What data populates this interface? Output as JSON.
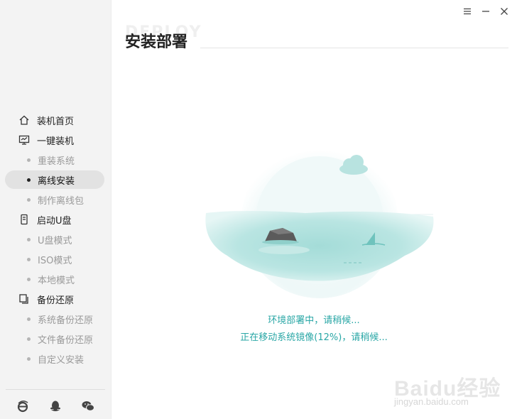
{
  "sidebar": {
    "items": [
      {
        "label": "装机首页",
        "icon": "home-icon",
        "type": "group"
      },
      {
        "label": "一键装机",
        "icon": "monitor-icon",
        "type": "group"
      },
      {
        "label": "重装系统",
        "type": "sub"
      },
      {
        "label": "离线安装",
        "type": "sub",
        "active": true
      },
      {
        "label": "制作离线包",
        "type": "sub"
      },
      {
        "label": "启动U盘",
        "icon": "usb-icon",
        "type": "group"
      },
      {
        "label": "U盘模式",
        "type": "sub"
      },
      {
        "label": "ISO模式",
        "type": "sub"
      },
      {
        "label": "本地模式",
        "type": "sub"
      },
      {
        "label": "备份还原",
        "icon": "backup-icon",
        "type": "group"
      },
      {
        "label": "系统备份还原",
        "type": "sub"
      },
      {
        "label": "文件备份还原",
        "type": "sub"
      },
      {
        "label": "自定义安装",
        "type": "sub"
      }
    ],
    "footer_icons": [
      "ie-browser-icon",
      "qq-penguin-icon",
      "wechat-icon"
    ]
  },
  "window_controls": [
    "menu-icon",
    "minimize-icon",
    "close-icon"
  ],
  "header": {
    "watermark": "DEPLOY",
    "title": "安装部署"
  },
  "status": {
    "line1": "环境部署中，请稍候...",
    "line2": "正在移动系统镜像(12%)，请稍候..."
  },
  "colors": {
    "accent": "#2aa7a6",
    "water": "#a8dedb",
    "sidebar_bg": "#f3f3f3"
  },
  "watermark": {
    "brand": "Baidu经验",
    "url": "jingyan.baidu.com"
  }
}
